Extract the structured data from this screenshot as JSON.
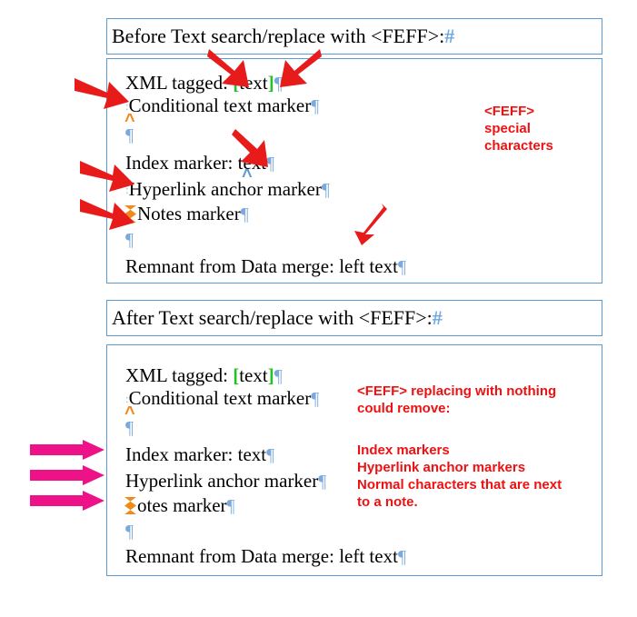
{
  "colors": {
    "frame_border": "#5b9bd5",
    "annotation_red": "#ee1111",
    "arrow_red": "#e81b1b",
    "arrow_magenta": "#ee1289",
    "pilcrow_blue": "#7aa9dd",
    "end_of_story_blue": "#6fa8e0",
    "xml_bracket_green": "#28c028",
    "note_anchor_orange": "#f08a1a",
    "conditional_caret_orange": "#f08a1a",
    "index_caret_blue": "#5b9bd5"
  },
  "before": {
    "title": {
      "text": "Before Text search/replace with <FEFF>:",
      "end_of_story": "#"
    },
    "lines": {
      "xml_tagged_label": "XML tagged: ",
      "xml_tagged_bracket_open": "[",
      "xml_tagged_value": "text",
      "xml_tagged_bracket_close": "]",
      "conditional": "Conditional text marker",
      "index": "Index marker: text",
      "hyperlink": "Hyperlink anchor marker",
      "notes": "Notes marker",
      "remnant": "Remnant from Data merge: left text",
      "pilcrow": "¶"
    },
    "annotation": "<FEFF>\nspecial\ncharacters"
  },
  "after": {
    "title": {
      "text": "After Text search/replace with <FEFF>:",
      "end_of_story": "#"
    },
    "lines": {
      "xml_tagged_label": "XML tagged: ",
      "xml_tagged_bracket_open": "[",
      "xml_tagged_value": "text",
      "xml_tagged_bracket_close": "]",
      "conditional": "Conditional text marker",
      "index": "Index marker: text",
      "hyperlink": "Hyperlink anchor marker",
      "notes": "otes marker",
      "remnant": "Remnant from Data merge: left text",
      "pilcrow": "¶"
    },
    "annotation_heading": "<FEFF> replacing with nothing\ncould remove:",
    "annotation_list": "Index markers\nHyperlink anchor markers\nNormal characters that are next\nto a note."
  },
  "icons": {
    "red_arrow": "red-arrow",
    "magenta_arrow": "magenta-arrow",
    "note_anchor": "note-anchor-icon",
    "conditional_caret": "^",
    "index_caret": "^"
  }
}
